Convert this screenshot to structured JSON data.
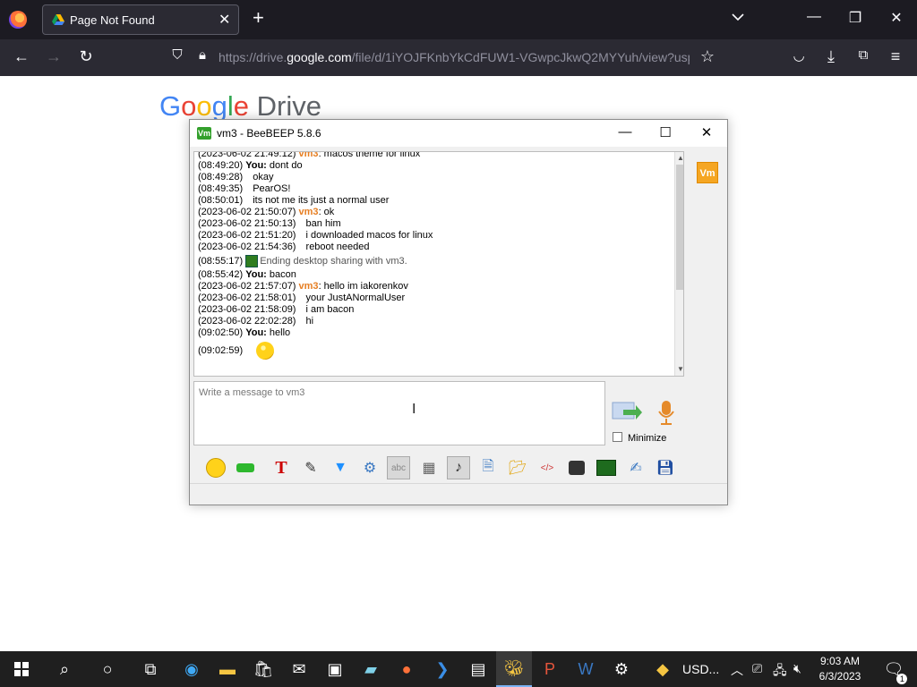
{
  "browser": {
    "tab_title": "Page Not Found",
    "url_prefix": "https://drive.",
    "url_domain": "google.com",
    "url_rest": "/file/d/1iYOJFKnbYkCdFUW1-VGwpcJkwQ2MYYuh/view?usp="
  },
  "page": {
    "logo_google": "Google",
    "logo_drive": "Drive"
  },
  "beebeep": {
    "title": "vm3 - BeeBEEP 5.8.6",
    "icon_text": "Vm",
    "side_badge": "Vm",
    "messages": [
      {
        "ts": "(2023-06-02 21:49:12)",
        "sender": "vm3",
        "text": ": macos theme for linux",
        "kind": "peer"
      },
      {
        "ts": "(08:49:20)",
        "sender": "You:",
        "text": " dont do",
        "kind": "me"
      },
      {
        "ts": "(08:49:28)",
        "sender": "",
        "text": "okay",
        "kind": "cont"
      },
      {
        "ts": "(08:49:35)",
        "sender": "",
        "text": "PearOS!",
        "kind": "cont"
      },
      {
        "ts": "(08:50:01)",
        "sender": "",
        "text": "its not me its just a normal user",
        "kind": "cont"
      },
      {
        "ts": "(2023-06-02 21:50:07)",
        "sender": "vm3",
        "text": ": ok",
        "kind": "peer"
      },
      {
        "ts": "(2023-06-02 21:50:13)",
        "sender": "",
        "text": "ban him",
        "kind": "cont"
      },
      {
        "ts": "(2023-06-02 21:51:20)",
        "sender": "",
        "text": "i downloaded macos for linux",
        "kind": "cont"
      },
      {
        "ts": "(2023-06-02 21:54:36)",
        "sender": "",
        "text": "reboot needed",
        "kind": "cont"
      },
      {
        "ts": "(08:55:17)",
        "sender": "",
        "text": "Ending desktop sharing with vm3.",
        "kind": "sys"
      },
      {
        "ts": "(08:55:42)",
        "sender": "You:",
        "text": " bacon",
        "kind": "me"
      },
      {
        "ts": "(2023-06-02 21:57:07)",
        "sender": "vm3",
        "text": ": hello im iakorenkov",
        "kind": "peer"
      },
      {
        "ts": "(2023-06-02 21:58:01)",
        "sender": "",
        "text": "your JustANormalUser",
        "kind": "cont"
      },
      {
        "ts": "(2023-06-02 21:58:09)",
        "sender": "",
        "text": "i am bacon",
        "kind": "cont"
      },
      {
        "ts": "(2023-06-02 22:02:28)",
        "sender": "",
        "text": "hi",
        "kind": "cont"
      },
      {
        "ts": "(09:02:50)",
        "sender": "You:",
        "text": " hello",
        "kind": "me"
      },
      {
        "ts": "(09:02:59)",
        "sender": "",
        "text": "",
        "kind": "smiley"
      }
    ],
    "input_placeholder": "Write a message to vm3",
    "minimize_label": "Minimize"
  },
  "taskbar": {
    "usd": "USD...",
    "time": "9:03 AM",
    "date": "6/3/2023",
    "notifications": "1"
  }
}
